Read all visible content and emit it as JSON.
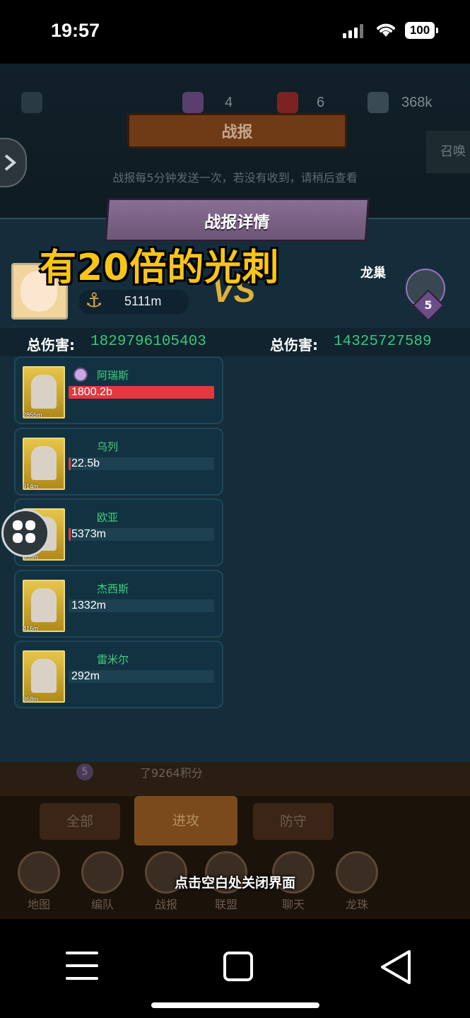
{
  "status_bar": {
    "time": "19:57",
    "battery": "100"
  },
  "top_stats": {
    "stat1": "4",
    "stat2": "6",
    "stat3": "368k"
  },
  "banner": {
    "title": "战报"
  },
  "hint": "战报每5分钟发送一次，若没有收到，请稍后查看",
  "right_tab": "召唤",
  "panel": {
    "title": "战报详情"
  },
  "overlay_caption": "有20倍的光刺",
  "player": {
    "power": "5111m"
  },
  "vs_label": "VS",
  "enemy": {
    "name": "龙巢",
    "level": "5"
  },
  "damage": {
    "left_label": "总伤害:",
    "left_value": "1829796105403",
    "right_label": "总伤害:",
    "right_value": "14325727589"
  },
  "heroes": [
    {
      "name": "阿瑞斯",
      "damage": "1800.2b",
      "fill": 1.0,
      "power": "2855m"
    },
    {
      "name": "乌列",
      "damage": "22.5b",
      "fill": 0.012,
      "power": "914m"
    },
    {
      "name": "欧亚",
      "damage": "5373m",
      "fill": 0.005,
      "power": "355m"
    },
    {
      "name": "杰西斯",
      "damage": "1332m",
      "fill": 0.0,
      "power": "416m"
    },
    {
      "name": "雷米尔",
      "damage": "292m",
      "fill": 0.0,
      "power": "368m"
    }
  ],
  "lower": {
    "badge": "5",
    "score_text": "了9264积分",
    "tabs": [
      "全部",
      "进攻",
      "防守"
    ],
    "nav": [
      "地图",
      "编队",
      "战报",
      "联盟",
      "聊天",
      "龙珠"
    ],
    "close_hint": "点击空白处关闭界面"
  },
  "colors": {
    "accent_green": "#38c77a",
    "bar_red": "#e2383f",
    "caption_yellow": "#f7c51a"
  }
}
